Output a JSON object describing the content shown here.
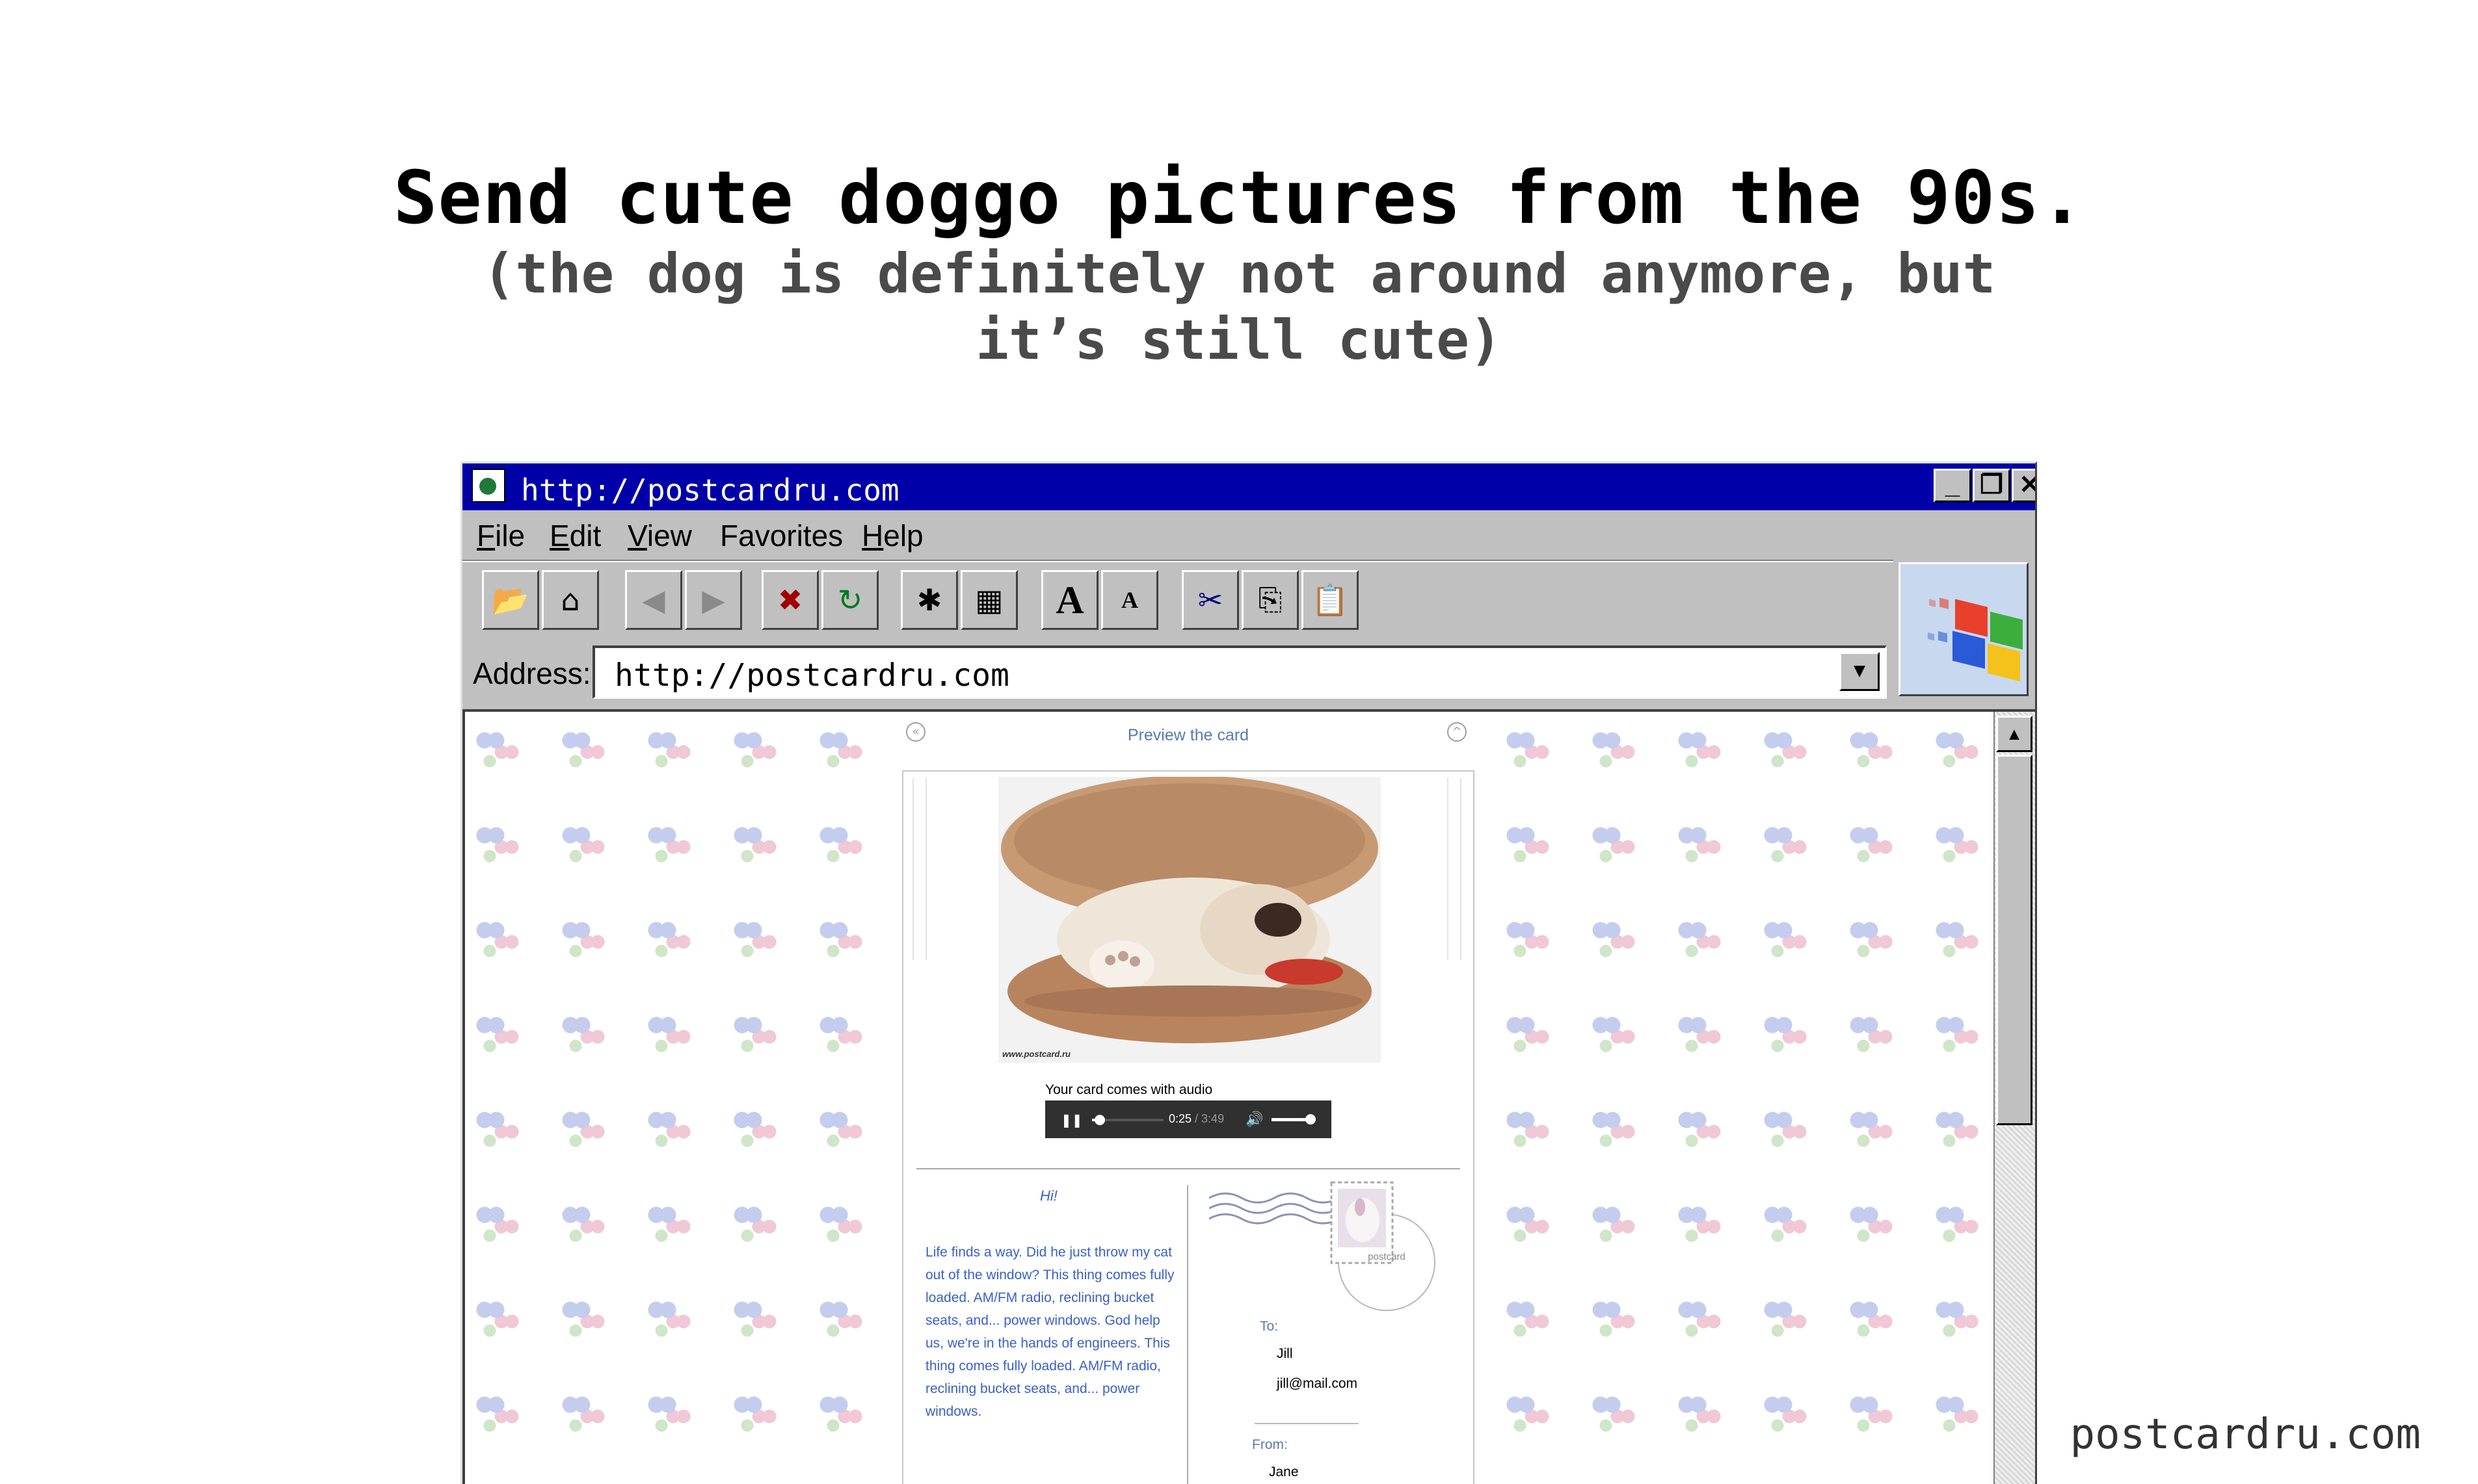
{
  "page": {
    "headline": "Send cute doggo pictures from the 90s.",
    "subheadline": "(the dog is definitely not around anymore, but it’s still cute)",
    "brand": "postcardru.com"
  },
  "window": {
    "title": "http://postcardru.com",
    "controls": {
      "minimize": "_",
      "restore": "❐",
      "close": "✕"
    },
    "menu": [
      {
        "first": "F",
        "rest": "ile"
      },
      {
        "first": "E",
        "rest": "dit"
      },
      {
        "first": "V",
        "rest": "iew"
      },
      {
        "first": "Fa",
        "rest": "vorites",
        "underline_index": 1
      },
      {
        "first": "H",
        "rest": "elp"
      }
    ],
    "toolbar": {
      "open_icon": "📂",
      "home_icon": "⌂",
      "back_icon": "◀",
      "forward_icon": "▶",
      "stop_icon": "✖",
      "refresh_icon": "↻",
      "favorites_icon": "✱",
      "history_icon": "▦",
      "font_larger_icon": "A",
      "font_smaller_icon": "A",
      "cut_icon": "✂",
      "copy_icon": "⎘",
      "paste_icon": "📋"
    },
    "address": {
      "label": "Address:",
      "value": "http://postcardru.com",
      "dropdown_icon": "▼"
    }
  },
  "card": {
    "header_title": "Preview the card",
    "nav_left_icon": "«",
    "nav_up_icon": "^",
    "photo_watermark": "www.postcard.ru",
    "audio_caption": "Your card comes with audio",
    "player": {
      "pause_icon": "❚❚",
      "current_time": "0:25",
      "total_time": " / 3:49",
      "volume_icon": "🔊",
      "progress": 0.11
    },
    "greeting": "Hi!",
    "message": "Life finds a way. Did he just throw my cat out of the window? This thing comes fully loaded. AM/FM radio, reclining bucket seats, and... power windows. God help us, we're in the hands of engineers. This thing comes fully loaded. AM/FM radio, reclining bucket seats, and... power windows.",
    "postmark_text": "postcard",
    "to_label": "To:",
    "to_name": "Jill",
    "to_email": "jill@mail.com",
    "from_label": "From:",
    "from_name": "Jane"
  }
}
